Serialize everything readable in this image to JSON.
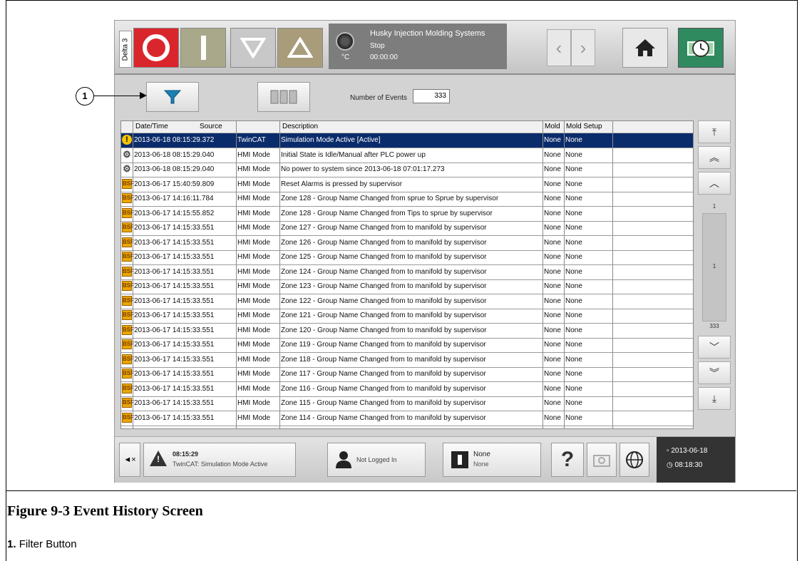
{
  "topbar": {
    "delta_label": "Delta 3",
    "status_title": "Husky Injection Molding Systems",
    "status_state": "Stop",
    "status_time": "00:00:00",
    "temp_unit": "°C",
    "icons": [
      "stop-icon",
      "start-icon",
      "down-triangle-icon",
      "up-triangle-icon",
      "back-icon",
      "forward-icon",
      "home-icon",
      "clock-icon"
    ]
  },
  "toolbar": {
    "events_label": "Number of Events",
    "events_count": "333"
  },
  "table": {
    "columns": [
      "Date/Time",
      "Source",
      "Description",
      "Mold",
      "Mold Setup"
    ],
    "rows": [
      {
        "icon": "warning",
        "dt": "2013-06-18 08:15:29.372",
        "src": "TwinCAT",
        "desc": "Simulation Mode Active [Active]",
        "mold": "None",
        "setup": "None",
        "selected": true
      },
      {
        "icon": "cog",
        "dt": "2013-06-18 08:15:29.040",
        "src": "HMI Mode",
        "desc": "Initial State is Idle/Manual after PLC power up",
        "mold": "None",
        "setup": "None"
      },
      {
        "icon": "cog",
        "dt": "2013-06-18 08:15:29.040",
        "src": "HMI Mode",
        "desc": "No power to system since 2013-06-18 07:01:17.273",
        "mold": "None",
        "setup": "None"
      },
      {
        "icon": "bsf",
        "dt": "2013-06-17 15:40:59.809",
        "src": "HMI Mode",
        "desc": "Reset Alarms is pressed by supervisor",
        "mold": "None",
        "setup": "None"
      },
      {
        "icon": "bsf",
        "dt": "2013-06-17 14:16:11.784",
        "src": "HMI Mode",
        "desc": "Zone 128 - Group Name Changed from sprue to Sprue  by supervisor",
        "mold": "None",
        "setup": "None"
      },
      {
        "icon": "bsf",
        "dt": "2013-06-17 14:15:55.852",
        "src": "HMI Mode",
        "desc": "Zone 128 - Group Name Changed from Tips to sprue  by supervisor",
        "mold": "None",
        "setup": "None"
      },
      {
        "icon": "bsf",
        "dt": "2013-06-17 14:15:33.551",
        "src": "HMI Mode",
        "desc": "Zone 127 - Group Name Changed from  to manifold  by supervisor",
        "mold": "None",
        "setup": "None"
      },
      {
        "icon": "bsf",
        "dt": "2013-06-17 14:15:33.551",
        "src": "HMI Mode",
        "desc": "Zone 126 - Group Name Changed from  to manifold  by supervisor",
        "mold": "None",
        "setup": "None"
      },
      {
        "icon": "bsf",
        "dt": "2013-06-17 14:15:33.551",
        "src": "HMI Mode",
        "desc": "Zone 125 - Group Name Changed from  to manifold  by supervisor",
        "mold": "None",
        "setup": "None"
      },
      {
        "icon": "bsf",
        "dt": "2013-06-17 14:15:33.551",
        "src": "HMI Mode",
        "desc": "Zone 124 - Group Name Changed from  to manifold  by supervisor",
        "mold": "None",
        "setup": "None"
      },
      {
        "icon": "bsf",
        "dt": "2013-06-17 14:15:33.551",
        "src": "HMI Mode",
        "desc": "Zone 123 - Group Name Changed from  to manifold  by supervisor",
        "mold": "None",
        "setup": "None"
      },
      {
        "icon": "bsf",
        "dt": "2013-06-17 14:15:33.551",
        "src": "HMI Mode",
        "desc": "Zone 122 - Group Name Changed from  to manifold  by supervisor",
        "mold": "None",
        "setup": "None"
      },
      {
        "icon": "bsf",
        "dt": "2013-06-17 14:15:33.551",
        "src": "HMI Mode",
        "desc": "Zone 121 - Group Name Changed from  to manifold  by supervisor",
        "mold": "None",
        "setup": "None"
      },
      {
        "icon": "bsf",
        "dt": "2013-06-17 14:15:33.551",
        "src": "HMI Mode",
        "desc": "Zone 120 - Group Name Changed from  to manifold  by supervisor",
        "mold": "None",
        "setup": "None"
      },
      {
        "icon": "bsf",
        "dt": "2013-06-17 14:15:33.551",
        "src": "HMI Mode",
        "desc": "Zone 119 - Group Name Changed from  to manifold  by supervisor",
        "mold": "None",
        "setup": "None"
      },
      {
        "icon": "bsf",
        "dt": "2013-06-17 14:15:33.551",
        "src": "HMI Mode",
        "desc": "Zone 118 - Group Name Changed from  to manifold  by supervisor",
        "mold": "None",
        "setup": "None"
      },
      {
        "icon": "bsf",
        "dt": "2013-06-17 14:15:33.551",
        "src": "HMI Mode",
        "desc": "Zone 117 - Group Name Changed from  to manifold  by supervisor",
        "mold": "None",
        "setup": "None"
      },
      {
        "icon": "bsf",
        "dt": "2013-06-17 14:15:33.551",
        "src": "HMI Mode",
        "desc": "Zone 116 - Group Name Changed from  to manifold  by supervisor",
        "mold": "None",
        "setup": "None"
      },
      {
        "icon": "bsf",
        "dt": "2013-06-17 14:15:33.551",
        "src": "HMI Mode",
        "desc": "Zone 115 - Group Name Changed from  to manifold  by supervisor",
        "mold": "None",
        "setup": "None"
      },
      {
        "icon": "bsf",
        "dt": "2013-06-17 14:15:33.551",
        "src": "HMI Mode",
        "desc": "Zone 114 - Group Name Changed from  to manifold  by supervisor",
        "mold": "None",
        "setup": "None"
      }
    ]
  },
  "scroller": {
    "top_num": "1",
    "mid_num": "1",
    "bottom_num": "333"
  },
  "footer": {
    "alarm_time": "08:15:29",
    "alarm_text": "TwinCAT: Simulation Mode Active",
    "login_text": "Not Logged In",
    "mold_title": "None",
    "mold_sub": "None",
    "help": "?",
    "date": "2013-06-18",
    "time": "08:18:30"
  },
  "callout_number": "1",
  "caption": "Figure 9-3   Event History Screen",
  "legend": {
    "num": "1.",
    "text": "Filter Button"
  },
  "colors": {
    "selected_row": "#0b2c6b",
    "stop_red": "#d9262c",
    "clock_green": "#2f8a5f"
  }
}
